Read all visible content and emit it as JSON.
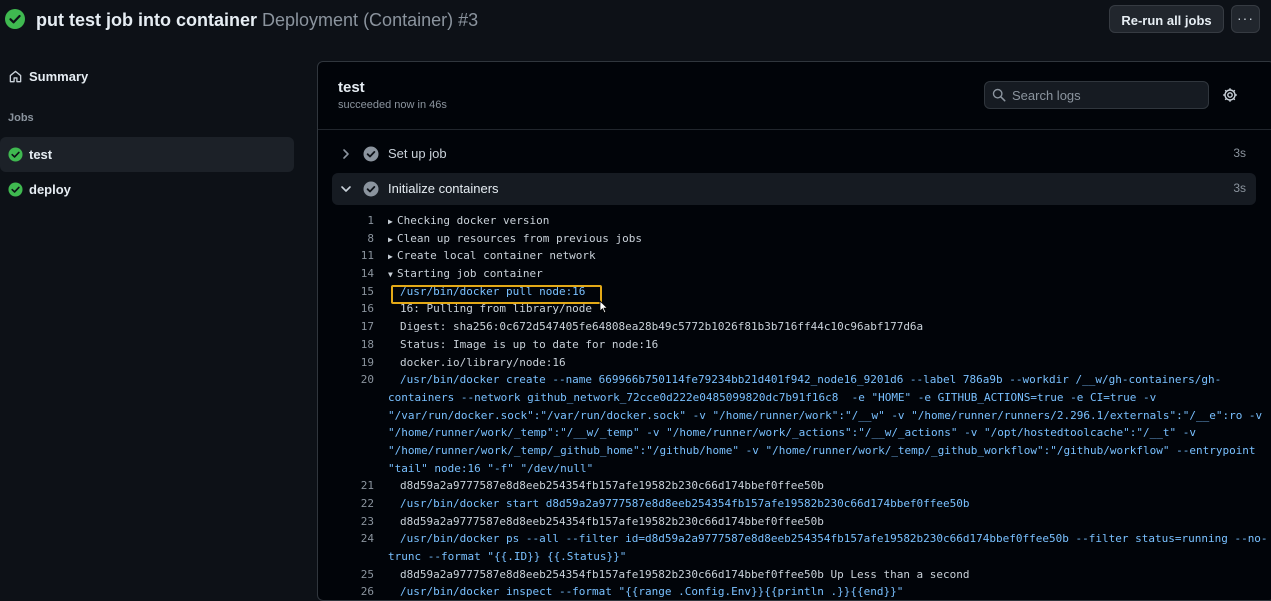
{
  "header": {
    "title_bold": "put test job into container",
    "title_muted": "Deployment (Container) #3",
    "rerun_label": "Re-run all jobs",
    "more_label": "···"
  },
  "sidebar": {
    "summary_label": "Summary",
    "jobs_heading": "Jobs",
    "jobs": [
      {
        "label": "test",
        "status": "success"
      },
      {
        "label": "deploy",
        "status": "success"
      }
    ]
  },
  "job": {
    "title": "test",
    "subtitle": "succeeded now in 46s",
    "search_placeholder": "Search logs"
  },
  "steps": [
    {
      "label": "Set up job",
      "time": "3s"
    },
    {
      "label": "Initialize containers",
      "time": "3s"
    }
  ],
  "logs": [
    {
      "n": "1",
      "text": "Checking docker version",
      "group": "collapsed"
    },
    {
      "n": "8",
      "text": "Clean up resources from previous jobs",
      "group": "collapsed"
    },
    {
      "n": "11",
      "text": "Create local container network",
      "group": "collapsed"
    },
    {
      "n": "14",
      "text": "Starting job container",
      "group": "expanded"
    },
    {
      "n": "15",
      "text": "/usr/bin/docker pull node:16",
      "cmd": true
    },
    {
      "n": "16",
      "text": "16: Pulling from library/node"
    },
    {
      "n": "17",
      "text": "Digest: sha256:0c672d547405fe64808ea28b49c5772b1026f81b3b716ff44c10c96abf177d6a"
    },
    {
      "n": "18",
      "text": "Status: Image is up to date for node:16"
    },
    {
      "n": "19",
      "text": "docker.io/library/node:16"
    },
    {
      "n": "20",
      "text": "/usr/bin/docker create --name 669966b750114fe79234bb21d401f942_node16_9201d6 --label 786a9b --workdir /__w/gh-containers/gh-",
      "cmd": true
    },
    {
      "n": "",
      "text": "containers --network github_network_72cce0d222e0485099820dc7b91f16c8  -e \"HOME\" -e GITHUB_ACTIONS=true -e CI=true -v",
      "cmd": true,
      "wrap": true
    },
    {
      "n": "",
      "text": "\"/var/run/docker.sock\":\"/var/run/docker.sock\" -v \"/home/runner/work\":\"/__w\" -v \"/home/runner/runners/2.296.1/externals\":\"/__e\":ro -v",
      "cmd": true,
      "wrap": true
    },
    {
      "n": "",
      "text": "\"/home/runner/work/_temp\":\"/__w/_temp\" -v \"/home/runner/work/_actions\":\"/__w/_actions\" -v \"/opt/hostedtoolcache\":\"/__t\" -v",
      "cmd": true,
      "wrap": true
    },
    {
      "n": "",
      "text": "\"/home/runner/work/_temp/_github_home\":\"/github/home\" -v \"/home/runner/work/_temp/_github_workflow\":\"/github/workflow\" --entrypoint",
      "cmd": true,
      "wrap": true
    },
    {
      "n": "",
      "text": "\"tail\" node:16 \"-f\" \"/dev/null\"",
      "cmd": true,
      "wrap": true
    },
    {
      "n": "21",
      "text": "d8d59a2a9777587e8d8eeb254354fb157afe19582b230c66d174bbef0ffee50b"
    },
    {
      "n": "22",
      "text": "/usr/bin/docker start d8d59a2a9777587e8d8eeb254354fb157afe19582b230c66d174bbef0ffee50b",
      "cmd": true
    },
    {
      "n": "23",
      "text": "d8d59a2a9777587e8d8eeb254354fb157afe19582b230c66d174bbef0ffee50b"
    },
    {
      "n": "24",
      "text": "/usr/bin/docker ps --all --filter id=d8d59a2a9777587e8d8eeb254354fb157afe19582b230c66d174bbef0ffee50b --filter status=running --no-",
      "cmd": true
    },
    {
      "n": "",
      "text": "trunc --format \"{{.ID}} {{.Status}}\"",
      "cmd": true,
      "wrap": true
    },
    {
      "n": "25",
      "text": "d8d59a2a9777587e8d8eeb254354fb157afe19582b230c66d174bbef0ffee50b Up Less than a second"
    },
    {
      "n": "26",
      "text": "/usr/bin/docker inspect --format \"{{range .Config.Env}}{{println .}}{{end}}\"",
      "cmd": true
    }
  ],
  "colors": {
    "success": "#3fb950",
    "command": "#79c0ff",
    "highlight": "#e3a917"
  }
}
